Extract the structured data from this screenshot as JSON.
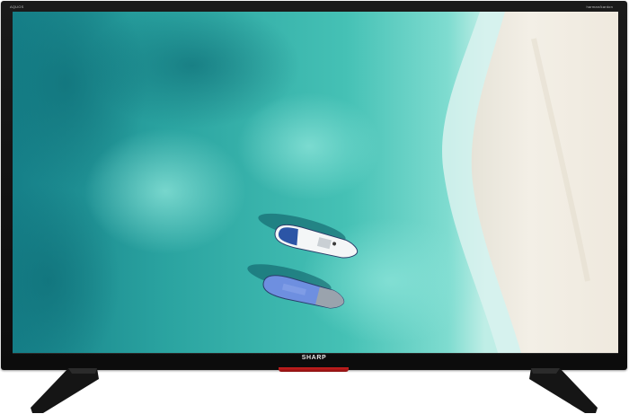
{
  "tv": {
    "brand_label": "SHARP",
    "series_label": "AQUOS",
    "audio_label": "harman/kardon"
  },
  "colors": {
    "bezel": "#111111",
    "led_strip": "#b51a1a",
    "deep_water": "#1a8a92",
    "shallow_water": "#5fd0c6",
    "sand": "#f1ece3"
  },
  "screen_image": {
    "subject": "aerial beach with two boats",
    "icons": [
      "boat-icon",
      "boat-icon"
    ]
  }
}
